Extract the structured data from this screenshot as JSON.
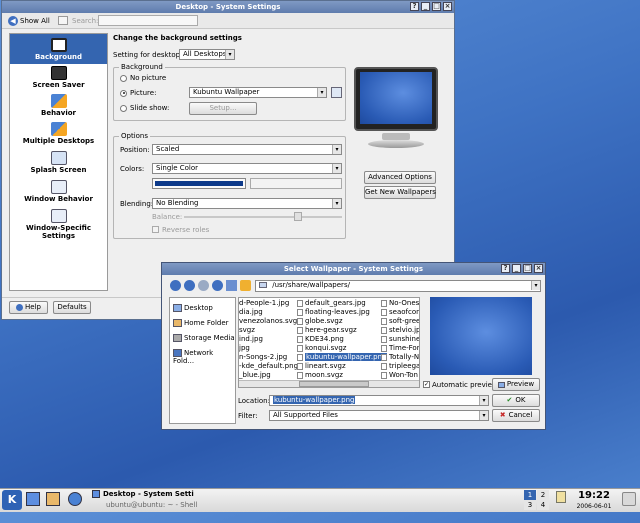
{
  "settings_window": {
    "title": "Desktop - System Settings",
    "toolbar": {
      "show_all": "Show All",
      "search_label": "Search:"
    },
    "sidebar": [
      {
        "label": "Background",
        "icon": "background-icon"
      },
      {
        "label": "Screen Saver",
        "icon": "screen-saver-icon"
      },
      {
        "label": "Behavior",
        "icon": "behavior-icon"
      },
      {
        "label": "Multiple Desktops",
        "icon": "desktops-icon"
      },
      {
        "label": "Splash Screen",
        "icon": "splash-icon"
      },
      {
        "label": "Window Behavior",
        "icon": "window-behavior-icon"
      },
      {
        "label": "Window-Specific Settings",
        "icon": "window-specific-icon"
      }
    ],
    "heading": "Change the background settings",
    "setting_for_label": "Setting for desktop:",
    "setting_for_value": "All Desktops",
    "background_group": "Background",
    "no_picture": "No picture",
    "picture": "Picture:",
    "picture_value": "Kubuntu Wallpaper",
    "slide_show": "Slide show:",
    "setup": "Setup...",
    "options_group": "Options",
    "position_label": "Position:",
    "position_value": "Scaled",
    "colors_label": "Colors:",
    "colors_value": "Single Color",
    "color_swatch": "#0d3a8a",
    "blending_label": "Blending:",
    "blending_value": "No Blending",
    "balance_label": "Balance:",
    "reverse_roles": "Reverse roles",
    "advanced_options": "Advanced Options",
    "get_new_wallpapers": "Get New Wallpapers",
    "help": "Help",
    "defaults": "Defaults"
  },
  "dialog": {
    "title": "Select Wallpaper - System Settings",
    "path": "/usr/share/wallpapers/",
    "places": [
      "Desktop",
      "Home Folder",
      "Storage Media",
      "Network Fold..."
    ],
    "columns": [
      [
        "d-People-1.jpg",
        "dia.jpg",
        "venezolanos.svgz",
        "svgz",
        "ind.jpg",
        "jpg",
        "n-Songs-2.jpg",
        "-kde_default.png",
        "_blue.jpg"
      ],
      [
        "default_gears.jpg",
        "floating-leaves.jpg",
        "globe.svgz",
        "here-gear.svgz",
        "KDE34.png",
        "konqui.svgz",
        "kubuntu-wallpaper.png",
        "lineart.svgz",
        "moon.svgz"
      ],
      [
        "No-Ones-",
        "seaofcon",
        "soft-gree",
        "stelvio.jp",
        "sunshine",
        "Time-For-",
        "Totally-N",
        "tripleega",
        "Won-Ton"
      ]
    ],
    "selected_file": "kubuntu-wallpaper.png",
    "automatic_preview": "Automatic preview",
    "preview": "Preview",
    "location_label": "Location:",
    "location_value": "kubuntu-wallpaper.png",
    "filter_label": "Filter:",
    "filter_value": "All Supported Files",
    "ok": "OK",
    "cancel": "Cancel"
  },
  "taskbar": {
    "task1": "Desktop - System Settin",
    "task2": "ubuntu@ubuntu: ~ - Shell",
    "desktops": [
      "1",
      "2",
      "3",
      "4"
    ],
    "time": "19:22",
    "date": "2006-06-01"
  },
  "colors": {
    "accent": "#6682b8",
    "selection": "#3465b0",
    "desktop": "#3f73c4"
  }
}
